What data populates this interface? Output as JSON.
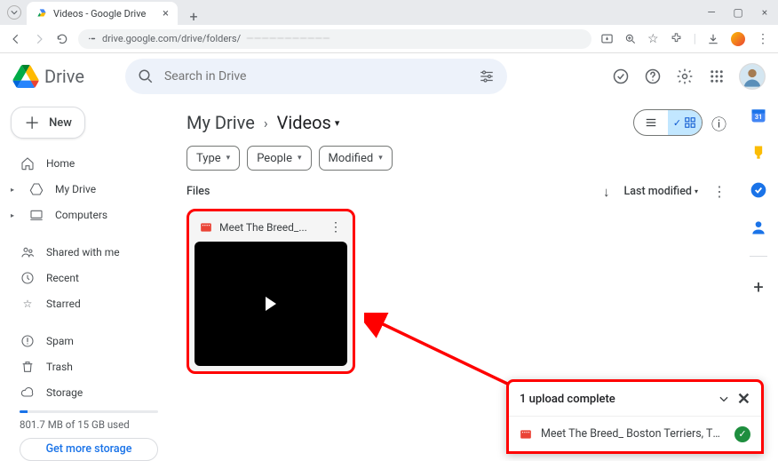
{
  "browser": {
    "tab_title": "Videos - Google Drive",
    "url_prefix": "drive.google.com/drive/folders/",
    "url_hidden": "———————————"
  },
  "drive": {
    "name": "Drive",
    "search_placeholder": "Search in Drive",
    "new_button": "New"
  },
  "sidebar": {
    "items": [
      {
        "label": "Home",
        "icon": "home"
      },
      {
        "label": "My Drive",
        "icon": "mydrive",
        "expandable": true
      },
      {
        "label": "Computers",
        "icon": "computers",
        "expandable": true
      }
    ],
    "items2": [
      {
        "label": "Shared with me",
        "icon": "shared"
      },
      {
        "label": "Recent",
        "icon": "clock"
      },
      {
        "label": "Starred",
        "icon": "star"
      }
    ],
    "items3": [
      {
        "label": "Spam",
        "icon": "spam"
      },
      {
        "label": "Trash",
        "icon": "trash"
      },
      {
        "label": "Storage",
        "icon": "cloud"
      }
    ],
    "storage_text": "801.7 MB of 15 GB used",
    "get_storage": "Get more storage"
  },
  "breadcrumb": {
    "root": "My Drive",
    "current": "Videos"
  },
  "filters": [
    "Type",
    "People",
    "Modified"
  ],
  "list": {
    "section": "Files",
    "sort": "Last modified"
  },
  "file": {
    "name": "Meet The Breed_..."
  },
  "upload": {
    "title": "1 upload complete",
    "file": "Meet The Breed_ Boston Terriers, The ..."
  }
}
